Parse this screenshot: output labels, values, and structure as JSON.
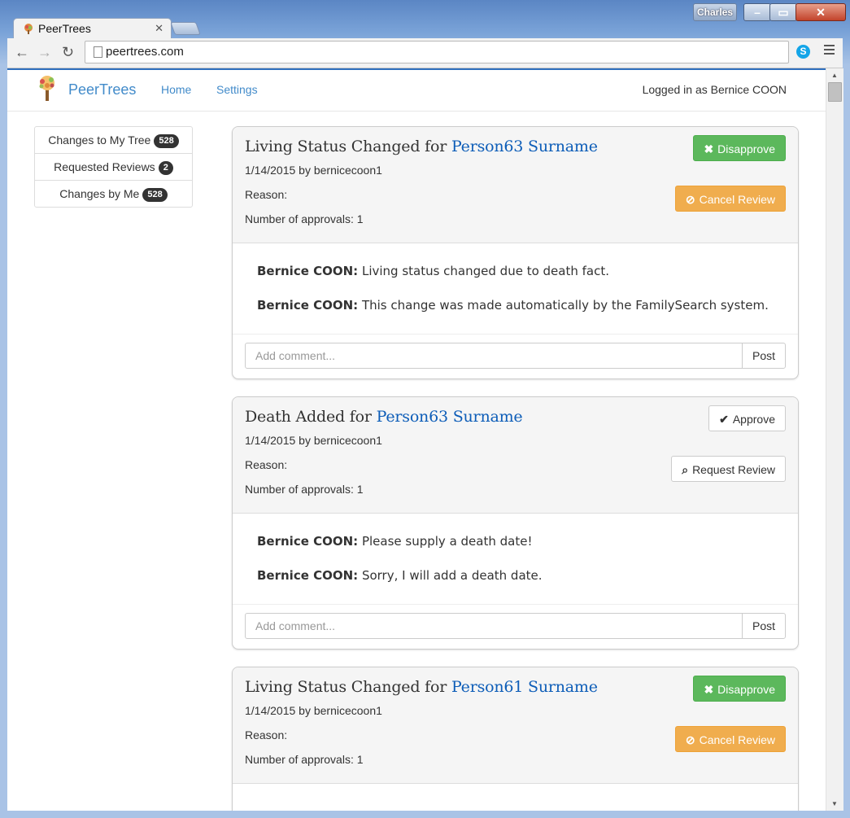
{
  "browser": {
    "profile_name": "Charles",
    "tab_title": "PeerTrees",
    "url": "peertrees.com"
  },
  "navbar": {
    "brand": "PeerTrees",
    "links": [
      "Home",
      "Settings"
    ],
    "logged_in": "Logged in as Bernice COON"
  },
  "sidebar": {
    "items": [
      {
        "label": "Changes to My Tree",
        "count": "528"
      },
      {
        "label": "Requested Reviews",
        "count": "2"
      },
      {
        "label": "Changes by Me",
        "count": "528"
      }
    ]
  },
  "cards": [
    {
      "title_prefix": "Living Status Changed for ",
      "person": "Person63 Surname",
      "date_line": "1/14/2015 by bernicecoon1",
      "reason": "Reason:",
      "approvals": "Number of approvals: 1",
      "btn1": {
        "icon": "✖",
        "label": "Disapprove"
      },
      "btn2": {
        "icon": "⊘",
        "label": "Cancel Review"
      },
      "comments": [
        {
          "author": "Bernice COON:",
          "text": " Living status changed due to death fact."
        },
        {
          "author": "Bernice COON:",
          "text": " This change was made automatically by the FamilySearch system."
        }
      ],
      "comment_placeholder": "Add comment...",
      "post_label": "Post"
    },
    {
      "title_prefix": "Death Added for ",
      "person": "Person63 Surname",
      "date_line": "1/14/2015 by bernicecoon1",
      "reason": "Reason:",
      "approvals": "Number of approvals: 1",
      "btn1": {
        "icon": "✔",
        "label": "Approve"
      },
      "btn2": {
        "icon": "⌕",
        "label": "Request Review"
      },
      "comments": [
        {
          "author": "Bernice COON:",
          "text": " Please supply a death date!"
        },
        {
          "author": "Bernice COON:",
          "text": " Sorry, I will add a death date."
        }
      ],
      "comment_placeholder": "Add comment...",
      "post_label": "Post"
    },
    {
      "title_prefix": "Living Status Changed for ",
      "person": "Person61 Surname",
      "date_line": "1/14/2015 by bernicecoon1",
      "reason": "Reason:",
      "approvals": "Number of approvals: 1",
      "btn1": {
        "icon": "✖",
        "label": "Disapprove"
      },
      "btn2": {
        "icon": "⊘",
        "label": "Cancel Review"
      }
    }
  ]
}
